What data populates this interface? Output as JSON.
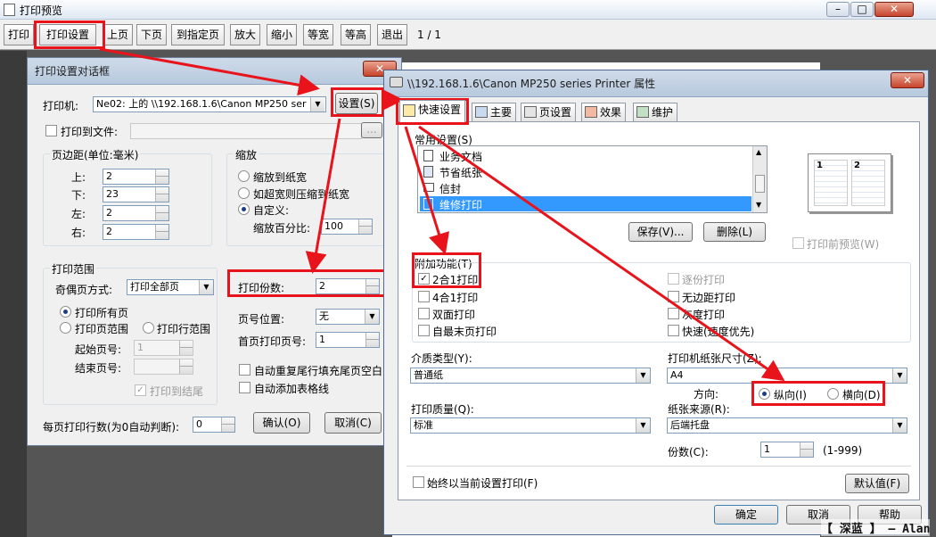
{
  "main_window": {
    "title": "打印预览",
    "toolbar": [
      "打印",
      "打印设置",
      "上页",
      "下页",
      "到指定页",
      "放大",
      "缩小",
      "等宽",
      "等高",
      "退出"
    ],
    "page_indicator": "1 / 1"
  },
  "print_setup": {
    "title": "打印设置对话框",
    "printer_label": "打印机:",
    "printer_value": "Ne02: 上的 \\\\192.168.1.6\\Canon MP250 ser",
    "setup_button": "设置(S)",
    "print_to_file": "打印到文件:",
    "margins_title": "页边距(单位:毫米)",
    "margins": [
      {
        "label": "上:",
        "value": "2"
      },
      {
        "label": "下:",
        "value": "23"
      },
      {
        "label": "左:",
        "value": "2"
      },
      {
        "label": "右:",
        "value": "2"
      }
    ],
    "scale_title": "缩放",
    "scale_options": [
      "缩放到纸宽",
      "如超宽则压缩到纸宽",
      "自定义:"
    ],
    "scale_percent_label": "缩放百分比:",
    "scale_percent_value": "100",
    "range_title": "打印范围",
    "odd_even_label": "奇偶页方式:",
    "odd_even_value": "打印全部页",
    "range_options": [
      "打印所有页",
      "打印页范围",
      "打印行范围"
    ],
    "start_page_label": "起始页号:",
    "start_page_value": "1",
    "end_page_label": "结束页号:",
    "print_to_end": "打印到结尾",
    "copies_label": "打印份数:",
    "copies_value": "2",
    "page_num_pos_label": "页号位置:",
    "page_num_pos_value": "无",
    "first_page_num_label": "首页打印页号:",
    "first_page_num_value": "1",
    "auto_fill": "自动重复尾行填充尾页空白",
    "auto_grid": "自动添加表格线",
    "rows_per_page_label": "每页打印行数(为0自动判断):",
    "rows_per_page_value": "0",
    "ok": "确认(O)",
    "cancel": "取消(C)"
  },
  "printer_props": {
    "title": "\\\\192.168.1.6\\Canon MP250 series Printer 属性",
    "close": "✕",
    "tabs": [
      "快速设置",
      "主要",
      "页设置",
      "效果",
      "维护"
    ],
    "common_settings_label": "常用设置(S)",
    "common_settings": [
      "业务文档",
      "节省纸张",
      "信封",
      "维修打印"
    ],
    "save_button": "保存(V)...",
    "delete_button": "删除(L)",
    "preview_before_print": "打印前预览(W)",
    "extra_features_label": "附加功能(T)",
    "features_left": [
      {
        "label": "2合1打印",
        "checked": true
      },
      {
        "label": "4合1打印",
        "checked": false
      },
      {
        "label": "双面打印",
        "checked": false
      },
      {
        "label": "自最末页打印",
        "checked": false
      }
    ],
    "features_right": [
      {
        "label": "逐份打印",
        "checked": false,
        "disabled": true
      },
      {
        "label": "无边距打印",
        "checked": false
      },
      {
        "label": "灰度打印",
        "checked": false
      },
      {
        "label": "快速(速度优先)",
        "checked": false
      }
    ],
    "media_type_label": "介质类型(Y):",
    "media_type_value": "普通纸",
    "paper_size_label": "打印机纸张尺寸(Z):",
    "paper_size_value": "A4",
    "orientation_label": "方向:",
    "portrait": "纵向(I)",
    "landscape": "横向(D)",
    "quality_label": "打印质量(Q):",
    "quality_value": "标准",
    "paper_source_label": "纸张来源(R):",
    "paper_source_value": "后端托盘",
    "copies_label": "份数(C):",
    "copies_value": "1",
    "copies_range": "(1-999)",
    "always_current": "始终以当前设置打印(F)",
    "defaults_button": "默认值(F)",
    "ok": "确定",
    "cancel": "取消",
    "help": "帮助"
  },
  "watermark": "【 深蓝 】 — Alan",
  "accent_color": "#e8131b",
  "selection_color": "#3399ff"
}
